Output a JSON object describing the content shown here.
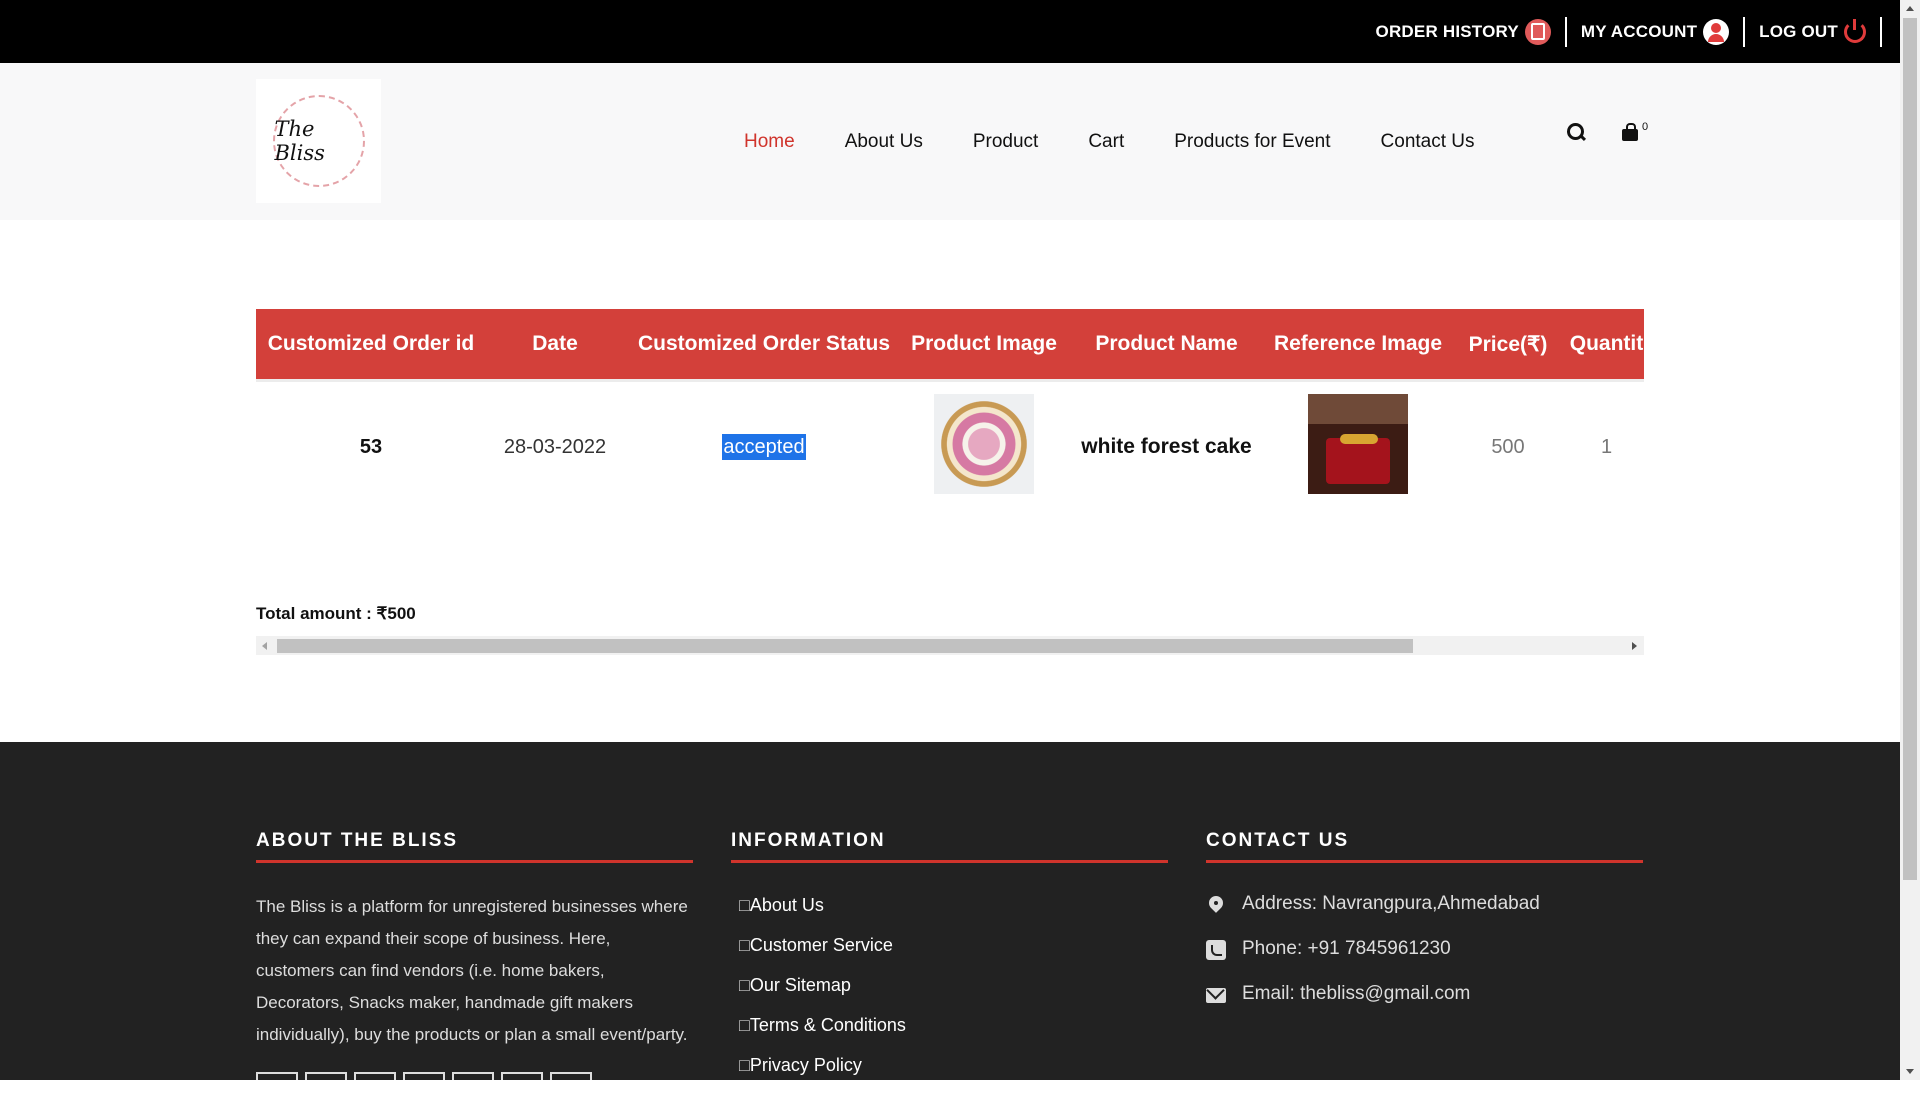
{
  "topbar": {
    "order_history": "ORDER HISTORY",
    "my_account": "MY ACCOUNT",
    "log_out": "LOG OUT"
  },
  "logo": {
    "text": "The Bliss"
  },
  "nav": {
    "items": [
      "Home",
      "About Us",
      "Product",
      "Cart",
      "Products for Event",
      "Contact Us"
    ],
    "active": "Home",
    "cart_count": "0"
  },
  "table": {
    "headers": [
      "Customized Order id",
      "Date",
      "Customized Order Status",
      "Product Image",
      "Product Name",
      "Reference Image",
      "Price(₹)",
      "Quantit"
    ],
    "row": {
      "order_id": "53",
      "date": "28-03-2022",
      "status": "accepted",
      "product_image": "cake-photo",
      "product_name": "white forest cake",
      "reference_image": "reference-cake-photo",
      "price": "500",
      "quantity": "1"
    }
  },
  "total": {
    "label": "Total amount : ₹500"
  },
  "footer": {
    "about": {
      "title": "ABOUT THE BLISS",
      "text": "The Bliss is a platform for unregistered businesses where they can expand their scope of business. Here, customers can find vendors (i.e. home bakers, Decorators, Snacks maker, handmade gift makers individually), buy the products or plan a small event/party."
    },
    "information": {
      "title": "INFORMATION",
      "links": [
        "About Us",
        "Customer Service",
        "Our Sitemap",
        "Terms & Conditions",
        "Privacy Policy"
      ]
    },
    "contact": {
      "title": "CONTACT US",
      "address": "Address: Navrangpura,Ahmedabad",
      "phone": "Phone: +91 7845961230",
      "email": "Email: thebliss@gmail.com"
    }
  },
  "colors": {
    "accent": "#d0342c",
    "table_header": "#d3403a",
    "topbar": "#000000",
    "footer": "#222222",
    "selection": "#1e73e8"
  }
}
